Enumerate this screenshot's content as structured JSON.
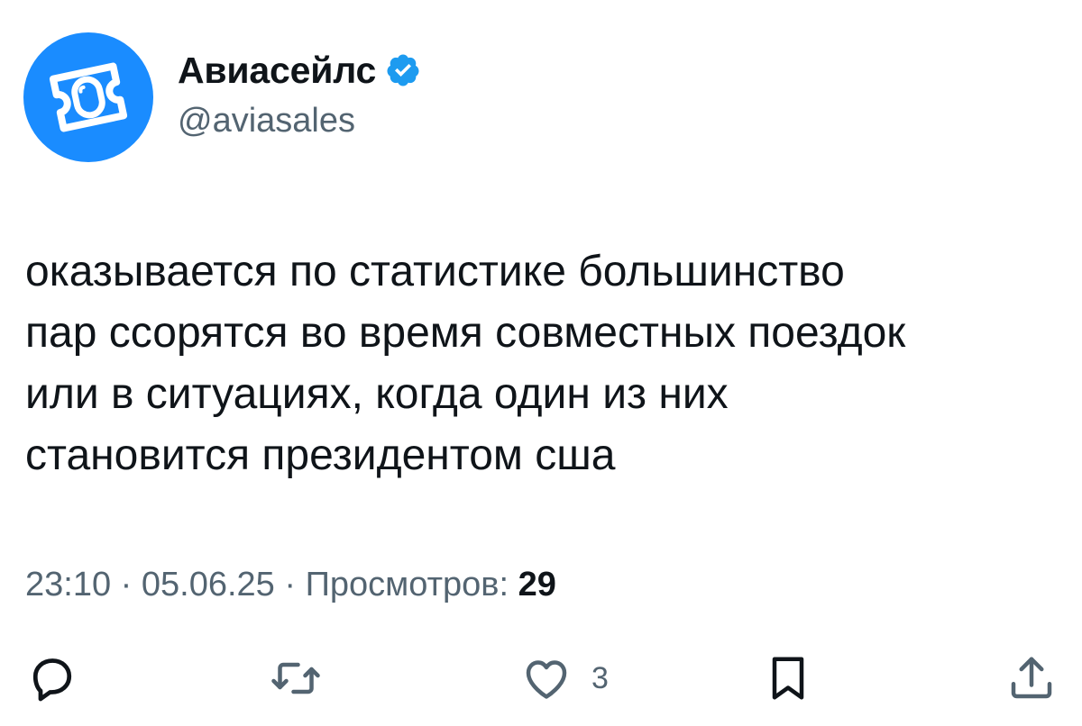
{
  "author": {
    "display_name": "Авиасейлс",
    "handle": "@aviasales",
    "verified": true,
    "avatar_icon": "aviasales-logo-icon",
    "avatar_color": "#1a8cff"
  },
  "tweet": {
    "lines": [
      "оказывается по статистике большинство",
      "пар ссорятся во время совместных поездок",
      "или в ситуациях, когда один из них",
      "становится президентом сша"
    ]
  },
  "meta": {
    "time": "23:10",
    "separator": " · ",
    "date": "05.06.25",
    "views_label": "Просмотров:",
    "views_count": "29"
  },
  "actions": {
    "reply": {
      "icon": "reply-icon"
    },
    "retweet": {
      "icon": "retweet-icon"
    },
    "like": {
      "icon": "heart-icon",
      "count": "3"
    },
    "bookmark": {
      "icon": "bookmark-icon"
    },
    "share": {
      "icon": "share-icon"
    }
  },
  "colors": {
    "text": "#0f1419",
    "secondary": "#536471",
    "verified": "#1d9bf0",
    "brand": "#1a8cff"
  }
}
